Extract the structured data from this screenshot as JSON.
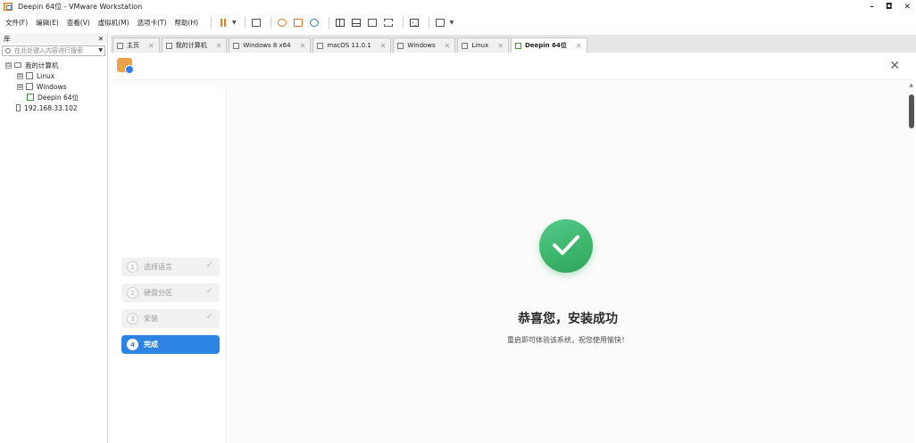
{
  "window": {
    "title": "Deepin 64位 - VMware Workstation",
    "controls": [
      "–",
      "◘",
      "✕"
    ]
  },
  "menu": [
    "文件(F)",
    "编辑(E)",
    "查看(V)",
    "虚拟机(M)",
    "选项卡(T)",
    "帮助(H)"
  ],
  "library": {
    "title": "库",
    "close": "✕",
    "search_placeholder": "在此处键入内容进行搜索",
    "tree": [
      {
        "label": "我的计算机",
        "expander": "⊟"
      },
      {
        "label": "Linux",
        "expander": "⊞"
      },
      {
        "label": "Windows",
        "expander": "⊞"
      },
      {
        "label": "Deepin 64位",
        "expander": ""
      },
      {
        "label": "192.168.33.102",
        "expander": ""
      }
    ]
  },
  "tabs": [
    {
      "label": "主页"
    },
    {
      "label": "我的计算机"
    },
    {
      "label": "Windows 8 x64"
    },
    {
      "label": "macOS 11.0.1"
    },
    {
      "label": "Windows"
    },
    {
      "label": "Linux"
    },
    {
      "label": "Deepin 64位",
      "active": true
    }
  ],
  "installer": {
    "close": "✕",
    "steps": [
      {
        "num": "1",
        "label": "选择语言",
        "done": true
      },
      {
        "num": "2",
        "label": "硬盘分区",
        "done": true
      },
      {
        "num": "3",
        "label": "安装",
        "done": true
      },
      {
        "num": "4",
        "label": "完成",
        "active": true
      }
    ],
    "success_title": "恭喜您，安装成功",
    "success_subtitle": "重启即可体验该系统，祝您使用愉快！"
  },
  "colors": {
    "accent": "#2d84e3",
    "success": "#3db46b",
    "pause": "#e4801e"
  }
}
